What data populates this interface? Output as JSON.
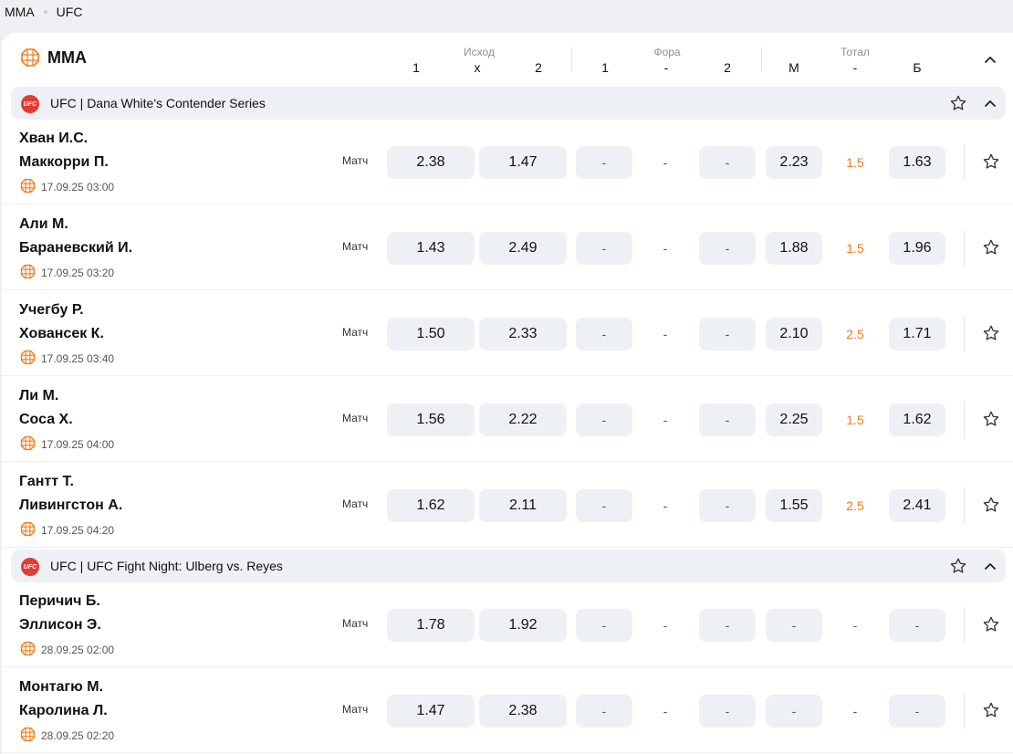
{
  "breadcrumb": [
    "MMA",
    "UFC"
  ],
  "sport": {
    "title": "MMA",
    "groups": {
      "outcome": "Исход",
      "handicap": "Фора",
      "total": "Тотал"
    },
    "cols": {
      "o1": "1",
      "ox": "x",
      "o2": "2",
      "h1": "1",
      "hdash": "-",
      "h2": "2",
      "tm": "М",
      "tdash": "-",
      "tb": "Б"
    }
  },
  "leagues": [
    {
      "name": "UFC | Dana White's Contender Series",
      "events": [
        {
          "team1": "Хван И.С.",
          "team2": "Маккорри П.",
          "datetime": "17.09.25 03:00",
          "market": "Матч",
          "odds": [
            "2.38",
            "1.47"
          ],
          "handicap": [
            "-",
            "-",
            "-"
          ],
          "total": [
            "2.23",
            "1.5",
            "1.63"
          ]
        },
        {
          "team1": "Али М.",
          "team2": "Бараневский И.",
          "datetime": "17.09.25 03:20",
          "market": "Матч",
          "odds": [
            "1.43",
            "2.49"
          ],
          "handicap": [
            "-",
            "-",
            "-"
          ],
          "total": [
            "1.88",
            "1.5",
            "1.96"
          ]
        },
        {
          "team1": "Учегбу Р.",
          "team2": "Ховансек К.",
          "datetime": "17.09.25 03:40",
          "market": "Матч",
          "odds": [
            "1.50",
            "2.33"
          ],
          "handicap": [
            "-",
            "-",
            "-"
          ],
          "total": [
            "2.10",
            "2.5",
            "1.71"
          ]
        },
        {
          "team1": "Ли М.",
          "team2": "Соса Х.",
          "datetime": "17.09.25 04:00",
          "market": "Матч",
          "odds": [
            "1.56",
            "2.22"
          ],
          "handicap": [
            "-",
            "-",
            "-"
          ],
          "total": [
            "2.25",
            "1.5",
            "1.62"
          ]
        },
        {
          "team1": "Гантт Т.",
          "team2": "Ливингстон А.",
          "datetime": "17.09.25 04:20",
          "market": "Матч",
          "odds": [
            "1.62",
            "2.11"
          ],
          "handicap": [
            "-",
            "-",
            "-"
          ],
          "total": [
            "1.55",
            "2.5",
            "2.41"
          ]
        }
      ]
    },
    {
      "name": "UFC | UFC Fight Night: Ulberg vs. Reyes",
      "events": [
        {
          "team1": "Перичич Б.",
          "team2": "Эллисон Э.",
          "datetime": "28.09.25 02:00",
          "market": "Матч",
          "odds": [
            "1.78",
            "1.92"
          ],
          "handicap": [
            "-",
            "-",
            "-"
          ],
          "total": [
            "-",
            "-",
            "-"
          ]
        },
        {
          "team1": "Монтагю М.",
          "team2": "Каролина Л.",
          "datetime": "28.09.25 02:20",
          "market": "Матч",
          "odds": [
            "1.47",
            "2.38"
          ],
          "handicap": [
            "-",
            "-",
            "-"
          ],
          "total": [
            "-",
            "-",
            "-"
          ]
        }
      ]
    }
  ],
  "icons": {
    "sport": "octagon-cage-icon",
    "league": "ufc-logo",
    "favorite": "star-icon",
    "collapse": "chevron-up-icon",
    "date": "octagon-cage-icon"
  },
  "colors": {
    "accent": "#f07c1c",
    "ufc_red": "#e23b33",
    "odd_bg": "#edf0f4"
  }
}
